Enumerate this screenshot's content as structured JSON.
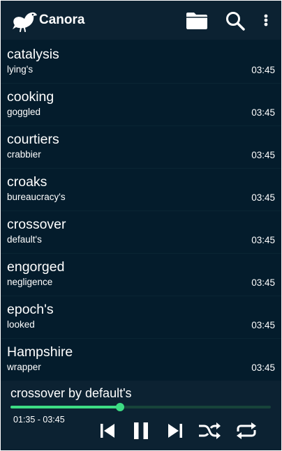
{
  "app": {
    "title": "Canora"
  },
  "colors": {
    "background": "#041c2c",
    "bar": "#0c2232",
    "accent": "#3ddc84",
    "text": "#ffffff"
  },
  "toolbar": {
    "icons": [
      "folder-icon",
      "search-icon",
      "more-vert-icon"
    ]
  },
  "tracks": [
    {
      "title": "catalysis",
      "artist": "lying's",
      "duration": "03:45"
    },
    {
      "title": "cooking",
      "artist": "goggled",
      "duration": "03:45"
    },
    {
      "title": "courtiers",
      "artist": "crabbier",
      "duration": "03:45"
    },
    {
      "title": "croaks",
      "artist": "bureaucracy's",
      "duration": "03:45"
    },
    {
      "title": "crossover",
      "artist": "default's",
      "duration": "03:45"
    },
    {
      "title": "engorged",
      "artist": "negligence",
      "duration": "03:45"
    },
    {
      "title": "epoch's",
      "artist": "looked",
      "duration": "03:45"
    },
    {
      "title": "Hampshire",
      "artist": "wrapper",
      "duration": "03:45"
    }
  ],
  "player": {
    "now_playing": "crossover by default's",
    "time_display": "01:35 - 03:45",
    "progress_fraction": 0.42,
    "controls": [
      "skip-previous-icon",
      "pause-icon",
      "skip-next-icon",
      "shuffle-icon",
      "repeat-icon"
    ]
  }
}
